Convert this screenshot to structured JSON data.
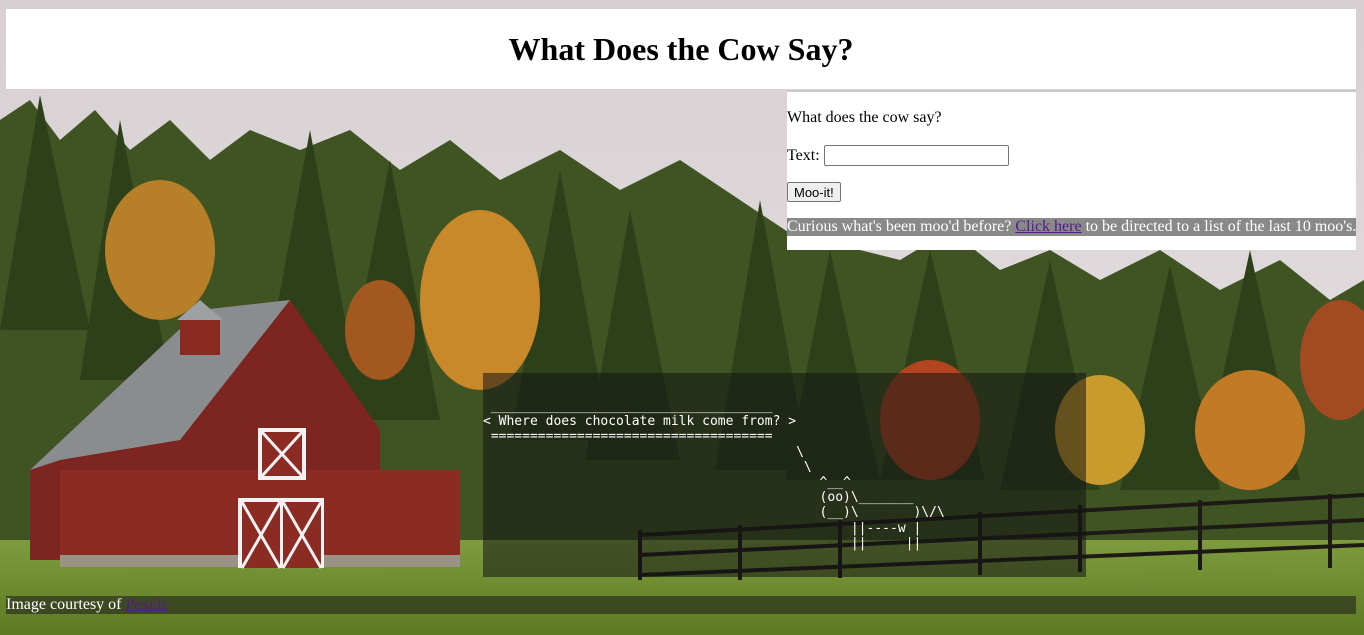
{
  "header": {
    "title": "What Does the Cow Say?"
  },
  "form": {
    "prompt": "What does the cow say?",
    "text_label": "Text:",
    "text_value": "",
    "submit_label": "Moo-it!"
  },
  "history": {
    "before": "Curious what's been moo'd before?",
    "link": "Click here",
    "after": "to be directed to a list of the last 10 moo's."
  },
  "cowsay": {
    "message": "Where does chocolate milk come from?",
    "art": " ____________________________________ \n< Where does chocolate milk come from? >\n ==================================== \n                                        \\\n                                         \\\n                                           ^__^\n                                           (oo)\\_______\n                                           (__)\\       )\\/\\\n                                               ||----w |\n                                               ||     ||"
  },
  "credit": {
    "text": "Image courtesy of",
    "link": "Pexels"
  },
  "colors": {
    "panel_background": "#ffffff",
    "history_background": "#898989",
    "visited_link": "#551a8b"
  }
}
